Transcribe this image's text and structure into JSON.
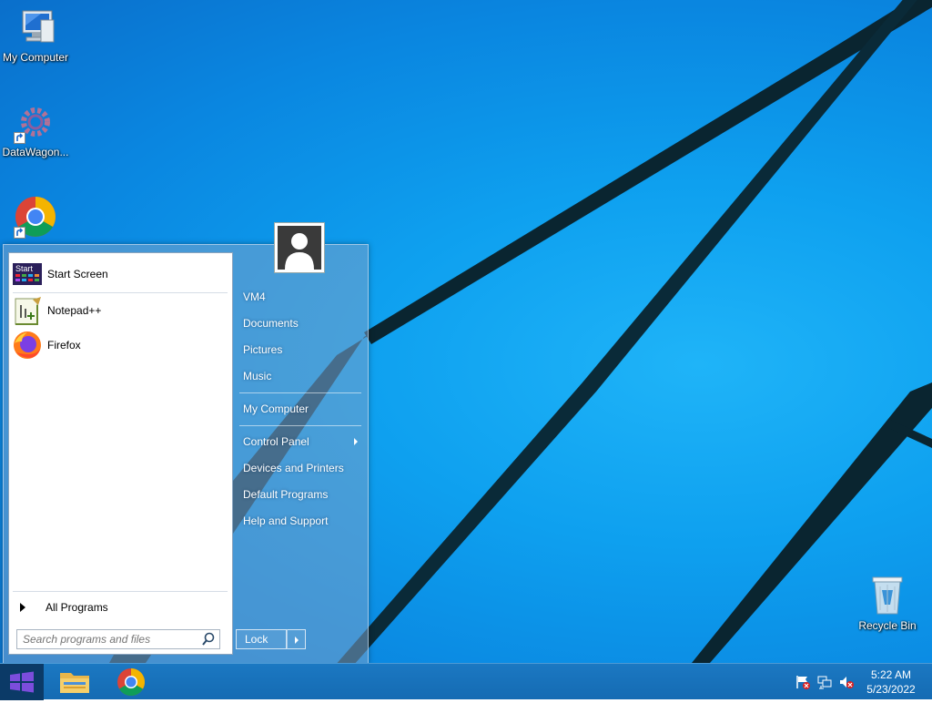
{
  "desktop": {
    "icons": [
      {
        "label": "My Computer",
        "icon": "computer-icon"
      },
      {
        "label": "DataWagon...",
        "icon": "gear-icon"
      },
      {
        "label": "",
        "icon": "chrome-icon"
      },
      {
        "label": "Recycle Bin",
        "icon": "recycle-bin-icon"
      }
    ]
  },
  "start_menu": {
    "programs": [
      {
        "label": "Start Screen",
        "icon": "start-screen-icon"
      },
      {
        "label": "Notepad++",
        "icon": "notepad-plus-plus-icon"
      },
      {
        "label": "Firefox",
        "icon": "firefox-icon"
      }
    ],
    "all_programs": "All Programs",
    "search": {
      "placeholder": "Search programs and files"
    },
    "start_screen_badge": "Start",
    "right": {
      "user": "VM4",
      "documents": "Documents",
      "pictures": "Pictures",
      "music": "Music",
      "my_computer": "My Computer",
      "control_panel": "Control Panel",
      "devices_printers": "Devices and Printers",
      "default_programs": "Default Programs",
      "help_support": "Help and Support"
    },
    "lock": "Lock"
  },
  "taskbar": {
    "items": [
      "windows-start-icon",
      "file-explorer-icon",
      "chrome-icon"
    ],
    "tray": [
      "action-center-flag-icon",
      "network-icon",
      "volume-muted-icon"
    ],
    "time": "5:22 AM",
    "date": "5/23/2022"
  },
  "colors": {
    "desktop_blue": "#0ea0ef",
    "taskbar_blue": "#156bb3",
    "start_button": "#0b3a67"
  }
}
